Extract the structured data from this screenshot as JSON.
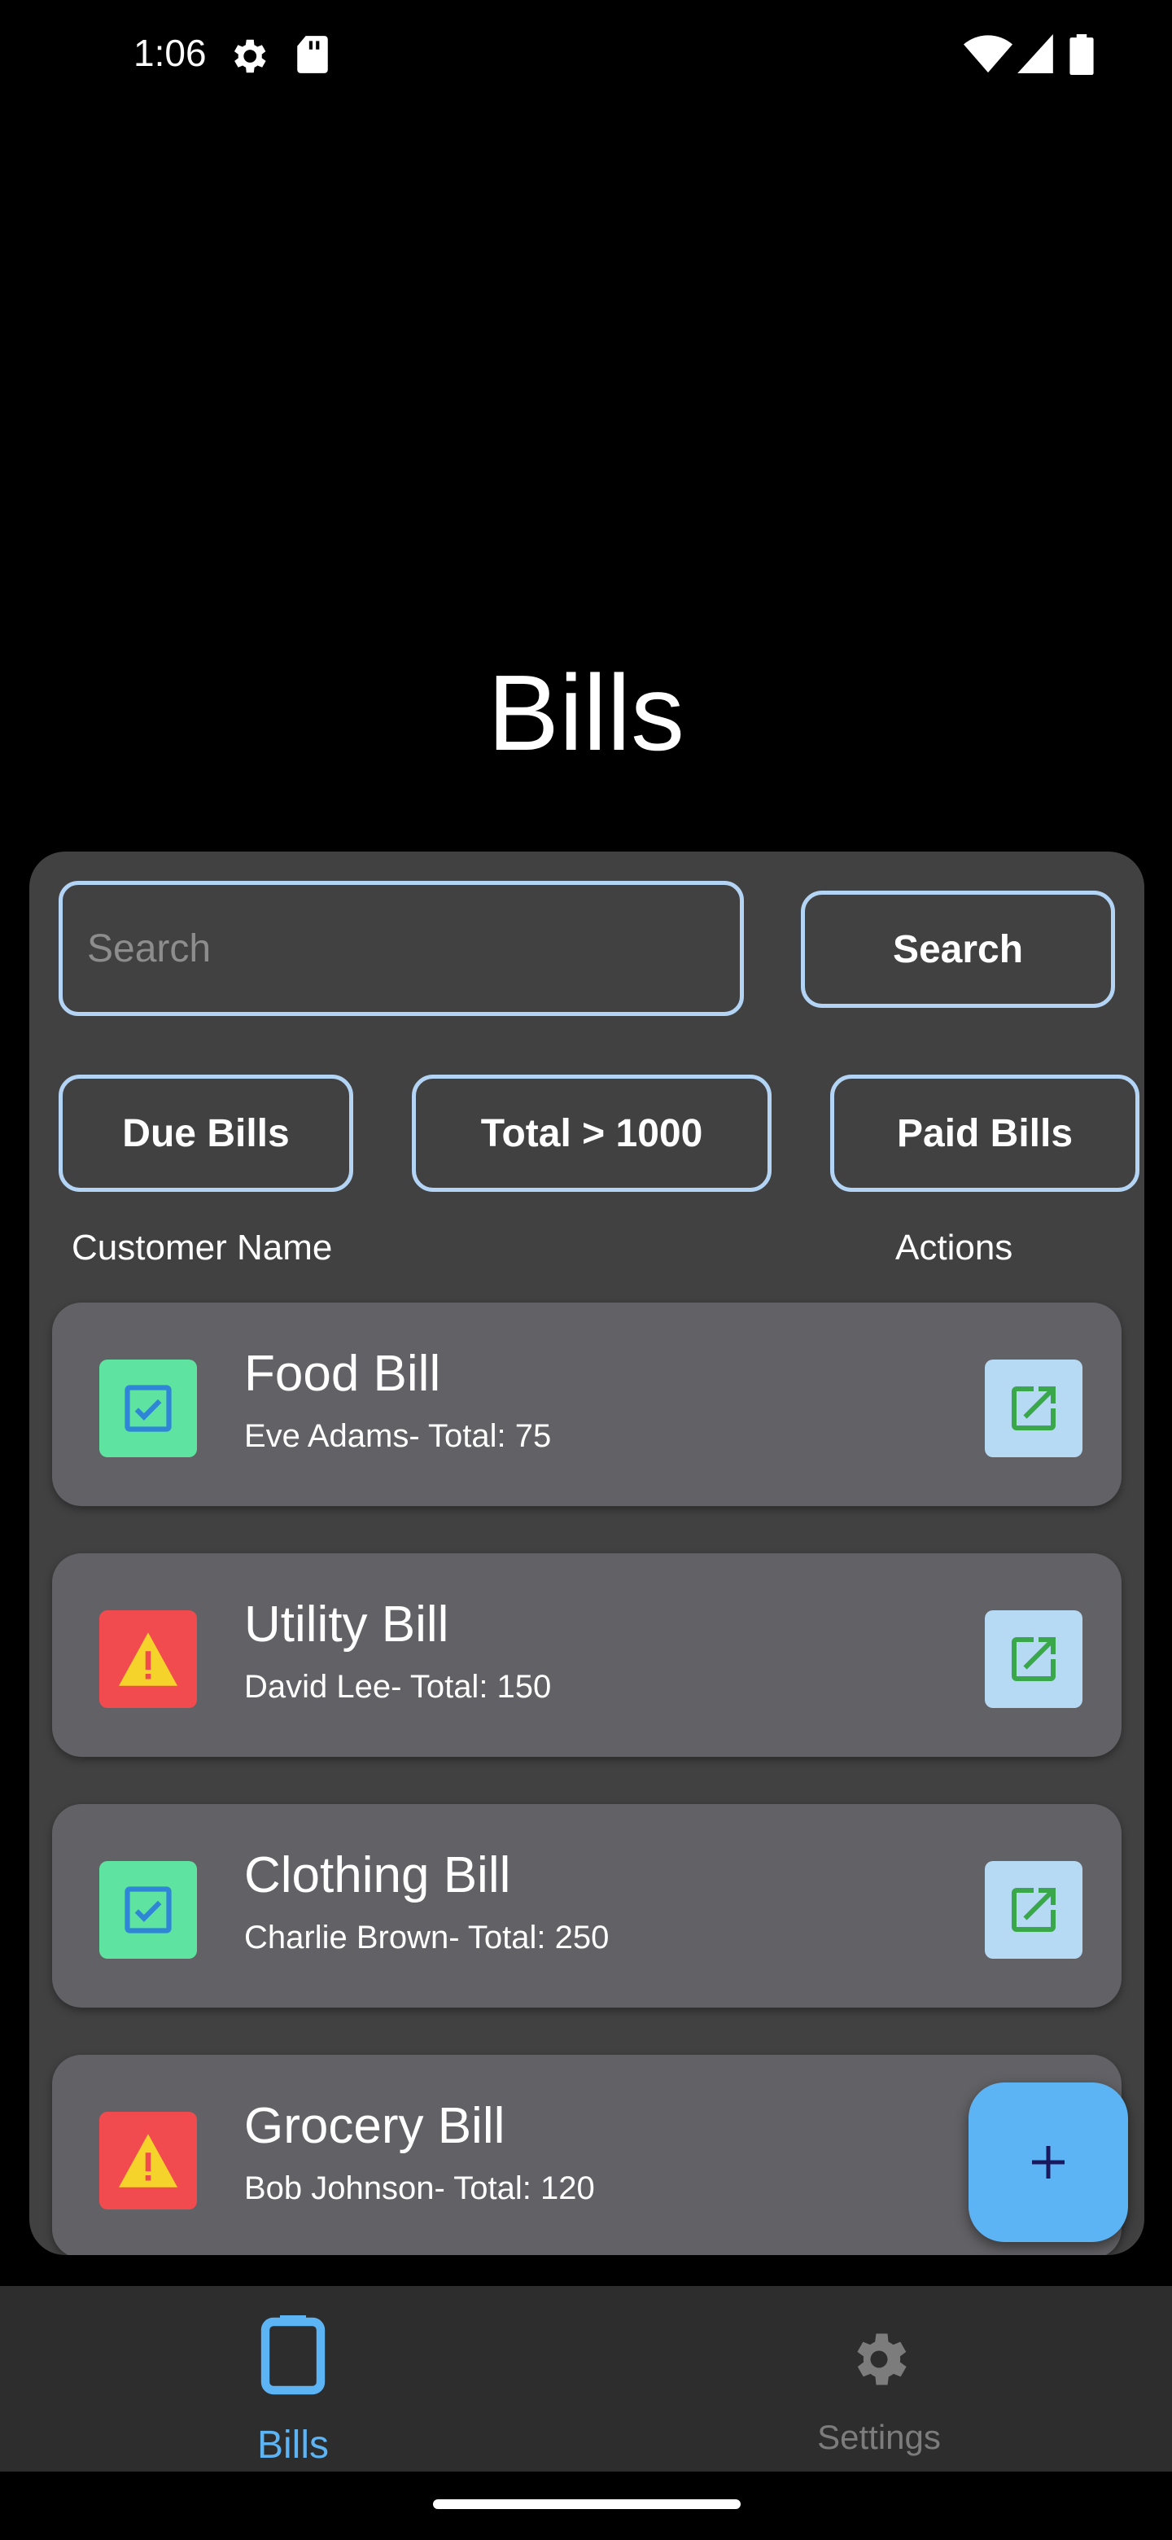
{
  "status_bar": {
    "time": "1:06",
    "icons": [
      "settings-gear-icon",
      "sd-card-icon",
      "wifi-icon",
      "signal-icon",
      "battery-icon"
    ]
  },
  "page": {
    "title": "Bills"
  },
  "search": {
    "placeholder": "Search",
    "button_label": "Search"
  },
  "filters": [
    {
      "label": "Due Bills"
    },
    {
      "label": "Total > 1000"
    },
    {
      "label": "Paid Bills"
    }
  ],
  "columns": {
    "name": "Customer Name",
    "actions": "Actions"
  },
  "bills": [
    {
      "title": "Food Bill",
      "subtitle": "Eve Adams- Total: 75",
      "status": "paid",
      "status_icon": "checkbox-icon"
    },
    {
      "title": "Utility Bill",
      "subtitle": "David Lee- Total: 150",
      "status": "due",
      "status_icon": "warning-icon"
    },
    {
      "title": "Clothing Bill",
      "subtitle": "Charlie Brown- Total: 250",
      "status": "paid",
      "status_icon": "checkbox-icon"
    },
    {
      "title": "Grocery Bill",
      "subtitle": "Bob Johnson- Total: 120",
      "status": "due",
      "status_icon": "warning-icon"
    }
  ],
  "fab": {
    "icon": "plus-icon"
  },
  "bottom_nav": {
    "items": [
      {
        "label": "Bills",
        "icon": "clipboard-icon",
        "active": true
      },
      {
        "label": "Settings",
        "icon": "gear-icon",
        "active": false
      }
    ]
  },
  "colors": {
    "accent": "#5db4f5",
    "paid": "#5fe3a0",
    "due": "#f24b4f",
    "warning_yellow": "#f5d32a",
    "card": "#626165",
    "panel": "#414141",
    "outline": "#b3d4f5"
  }
}
